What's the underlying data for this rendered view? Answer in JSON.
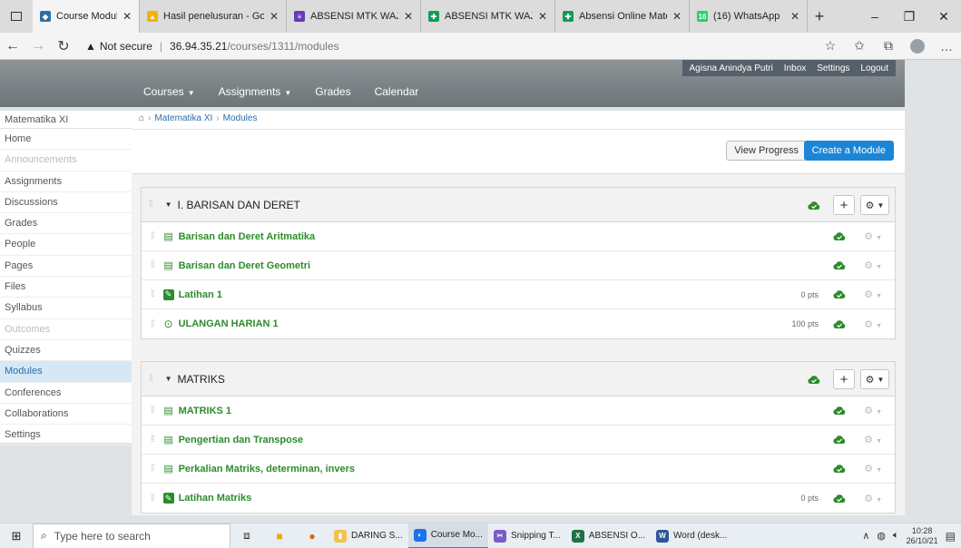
{
  "browser": {
    "tabs": [
      {
        "title": "Course Modules: Mate",
        "color": "#2a6ea8",
        "glyph": "◆",
        "active": true
      },
      {
        "title": "Hasil penelusuran - Go",
        "color": "#f4b400",
        "glyph": "▲"
      },
      {
        "title": "ABSENSI MTK WAJIB S",
        "color": "#673ab7",
        "glyph": "≡"
      },
      {
        "title": "ABSENSI MTK WAJIB S",
        "color": "#0f9d58",
        "glyph": "✚"
      },
      {
        "title": "Absensi Online Mater",
        "color": "#0f9d58",
        "glyph": "✚"
      },
      {
        "title": "(16) WhatsApp",
        "color": "#25d366",
        "glyph": "16"
      }
    ],
    "security_label": "Not secure",
    "url_host": "36.94.35.21",
    "url_path": "/courses/1311/modules"
  },
  "header": {
    "user_name": "Agisna Anindya Putri",
    "inbox": "Inbox",
    "settings": "Settings",
    "logout": "Logout",
    "nav": [
      "Courses",
      "Assignments",
      "Grades",
      "Calendar"
    ]
  },
  "sidebar": {
    "course_title": "Matematika XI",
    "items": [
      {
        "label": "Home",
        "state": ""
      },
      {
        "label": "Announcements",
        "state": "disabled"
      },
      {
        "label": "Assignments",
        "state": ""
      },
      {
        "label": "Discussions",
        "state": ""
      },
      {
        "label": "Grades",
        "state": ""
      },
      {
        "label": "People",
        "state": ""
      },
      {
        "label": "Pages",
        "state": ""
      },
      {
        "label": "Files",
        "state": ""
      },
      {
        "label": "Syllabus",
        "state": ""
      },
      {
        "label": "Outcomes",
        "state": "disabled"
      },
      {
        "label": "Quizzes",
        "state": ""
      },
      {
        "label": "Modules",
        "state": "active"
      },
      {
        "label": "Conferences",
        "state": ""
      },
      {
        "label": "Collaborations",
        "state": ""
      },
      {
        "label": "Settings",
        "state": ""
      }
    ]
  },
  "breadcrumb": {
    "course": "Matematika XI",
    "page": "Modules"
  },
  "actions": {
    "view_progress": "View Progress",
    "create_module": "Create a Module"
  },
  "modules": [
    {
      "title": "I. BARISAN DAN DERET",
      "items": [
        {
          "type": "page",
          "title": "Barisan dan Deret Aritmatika",
          "points": ""
        },
        {
          "type": "page",
          "title": "Barisan dan Deret Geometri",
          "points": ""
        },
        {
          "type": "assignment",
          "title": "Latihan 1",
          "points": "0 pts"
        },
        {
          "type": "quiz",
          "title": "ULANGAN HARIAN 1",
          "points": "100 pts"
        }
      ]
    },
    {
      "title": "MATRIKS",
      "items": [
        {
          "type": "page",
          "title": "MATRIKS 1",
          "points": ""
        },
        {
          "type": "page",
          "title": "Pengertian dan Transpose",
          "points": ""
        },
        {
          "type": "page",
          "title": "Perkalian Matriks, determinan, invers",
          "points": ""
        },
        {
          "type": "assignment",
          "title": "Latihan Matriks",
          "points": "0 pts"
        }
      ]
    }
  ],
  "taskbar": {
    "search_placeholder": "Type here to search",
    "apps": [
      {
        "label": "DARING S...",
        "color": "#f2c14e",
        "glyph": "▮"
      },
      {
        "label": "Course Mo...",
        "color": "#1a73e8",
        "glyph": "◐",
        "active": true
      },
      {
        "label": "Snipping T...",
        "color": "#7a5cc6",
        "glyph": "✂"
      },
      {
        "label": "ABSENSI O...",
        "color": "#1e7145",
        "glyph": "X"
      },
      {
        "label": "Word (desk...",
        "color": "#2b579a",
        "glyph": "W"
      }
    ],
    "time": "10:28",
    "date": "26/10/21"
  }
}
